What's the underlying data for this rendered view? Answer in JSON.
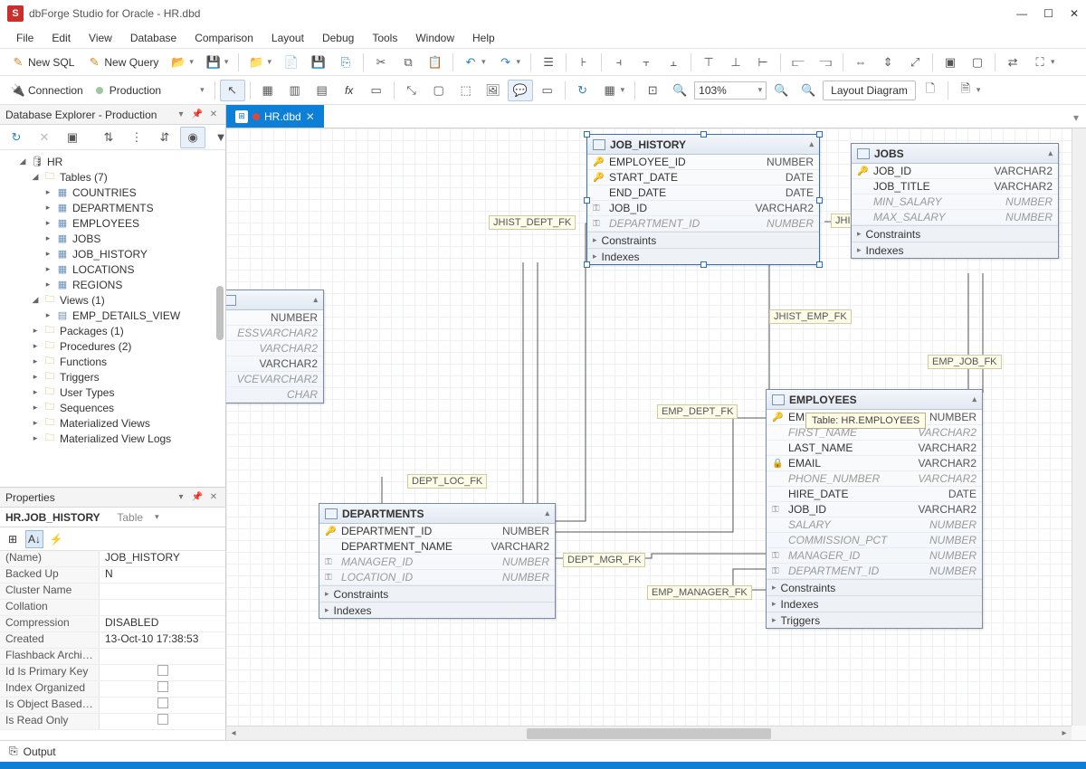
{
  "app": {
    "title": "dbForge Studio for Oracle - HR.dbd"
  },
  "menu": [
    "File",
    "Edit",
    "View",
    "Database",
    "Comparison",
    "Layout",
    "Debug",
    "Tools",
    "Window",
    "Help"
  ],
  "toolbar1": {
    "newSql": "New SQL",
    "newQuery": "New Query",
    "connection_label": "Connection",
    "connection_value": "Production"
  },
  "toolbar2": {
    "zoom": "103%",
    "layout_btn": "Layout Diagram"
  },
  "tab": {
    "label": "HR.dbd"
  },
  "explorer": {
    "title": "Database Explorer - Production",
    "db": "HR",
    "tables_label": "Tables (7)",
    "tables": [
      "COUNTRIES",
      "DEPARTMENTS",
      "EMPLOYEES",
      "JOBS",
      "JOB_HISTORY",
      "LOCATIONS",
      "REGIONS"
    ],
    "views_label": "Views (1)",
    "views": [
      "EMP_DETAILS_VIEW"
    ],
    "folders": [
      "Packages (1)",
      "Procedures (2)",
      "Functions",
      "Triggers",
      "User Types",
      "Sequences",
      "Materialized Views",
      "Materialized View Logs"
    ]
  },
  "properties": {
    "title": "Properties",
    "object": "HR.JOB_HISTORY",
    "object_type": "Table",
    "rows": [
      {
        "k": "(Name)",
        "v": "JOB_HISTORY"
      },
      {
        "k": "Backed Up",
        "v": "N"
      },
      {
        "k": "Cluster Name",
        "v": ""
      },
      {
        "k": "Collation",
        "v": ""
      },
      {
        "k": "Compression",
        "v": "DISABLED"
      },
      {
        "k": "Created",
        "v": "13-Oct-10 17:38:53"
      },
      {
        "k": "Flashback Archiv...",
        "v": ""
      },
      {
        "k": "Id Is Primary Key",
        "v": "[check]"
      },
      {
        "k": "Index Organized",
        "v": "[check]"
      },
      {
        "k": "Is Object Based ...",
        "v": "[check]"
      },
      {
        "k": "Is Read Only",
        "v": "[check]"
      }
    ]
  },
  "diagram": {
    "tooltip": "Table: HR.EMPLOYEES",
    "labels": {
      "jhist_dept": "JHIST_DEPT_FK",
      "jhist_job": "JHIST_JOB_FK",
      "jhist_emp": "JHIST_EMP_FK",
      "emp_job": "EMP_JOB_FK",
      "emp_dept": "EMP_DEPT_FK",
      "dept_mgr": "DEPT_MGR_FK",
      "emp_mgr": "EMP_MANAGER_FK",
      "dept_loc": "DEPT_LOC_FK"
    },
    "entities": {
      "job_history": {
        "name": "JOB_HISTORY",
        "cols": [
          {
            "i": "pk",
            "n": "EMPLOYEE_ID",
            "t": "NUMBER"
          },
          {
            "i": "pk",
            "n": "START_DATE",
            "t": "DATE"
          },
          {
            "i": "",
            "n": "END_DATE",
            "t": "DATE"
          },
          {
            "i": "fk",
            "n": "JOB_ID",
            "t": "VARCHAR2"
          },
          {
            "i": "fk",
            "n": "DEPARTMENT_ID",
            "t": "NUMBER",
            "grey": true
          }
        ],
        "subs": [
          "Constraints",
          "Indexes"
        ]
      },
      "jobs": {
        "name": "JOBS",
        "cols": [
          {
            "i": "pk",
            "n": "JOB_ID",
            "t": "VARCHAR2"
          },
          {
            "i": "",
            "n": "JOB_TITLE",
            "t": "VARCHAR2"
          },
          {
            "i": "",
            "n": "MIN_SALARY",
            "t": "NUMBER",
            "grey": true
          },
          {
            "i": "",
            "n": "MAX_SALARY",
            "t": "NUMBER",
            "grey": true
          }
        ],
        "subs": [
          "Constraints",
          "Indexes"
        ]
      },
      "employees": {
        "name": "EMPLOYEES",
        "cols": [
          {
            "i": "pk",
            "n": "EMPLOYEE_ID",
            "t": "NUMBER"
          },
          {
            "i": "",
            "n": "FIRST_NAME",
            "t": "VARCHAR2",
            "grey": true
          },
          {
            "i": "",
            "n": "LAST_NAME",
            "t": "VARCHAR2"
          },
          {
            "i": "uk",
            "n": "EMAIL",
            "t": "VARCHAR2"
          },
          {
            "i": "",
            "n": "PHONE_NUMBER",
            "t": "VARCHAR2",
            "grey": true
          },
          {
            "i": "",
            "n": "HIRE_DATE",
            "t": "DATE"
          },
          {
            "i": "fk",
            "n": "JOB_ID",
            "t": "VARCHAR2"
          },
          {
            "i": "",
            "n": "SALARY",
            "t": "NUMBER",
            "grey": true
          },
          {
            "i": "",
            "n": "COMMISSION_PCT",
            "t": "NUMBER",
            "grey": true
          },
          {
            "i": "fk",
            "n": "MANAGER_ID",
            "t": "NUMBER",
            "grey": true
          },
          {
            "i": "fk",
            "n": "DEPARTMENT_ID",
            "t": "NUMBER",
            "grey": true
          }
        ],
        "subs": [
          "Constraints",
          "Indexes",
          "Triggers"
        ]
      },
      "departments": {
        "name": "DEPARTMENTS",
        "cols": [
          {
            "i": "pk",
            "n": "DEPARTMENT_ID",
            "t": "NUMBER"
          },
          {
            "i": "",
            "n": "DEPARTMENT_NAME",
            "t": "VARCHAR2"
          },
          {
            "i": "fk",
            "n": "MANAGER_ID",
            "t": "NUMBER",
            "grey": true
          },
          {
            "i": "fk",
            "n": "LOCATION_ID",
            "t": "NUMBER",
            "grey": true
          }
        ],
        "subs": [
          "Constraints",
          "Indexes"
        ]
      },
      "partial": {
        "cols": [
          {
            "i": "",
            "n": "",
            "t": "NUMBER"
          },
          {
            "i": "",
            "n": "ESS",
            "t": "VARCHAR2",
            "grey": true
          },
          {
            "i": "",
            "n": "",
            "t": "VARCHAR2",
            "grey": true
          },
          {
            "i": "",
            "n": "",
            "t": "VARCHAR2"
          },
          {
            "i": "",
            "n": "VCE",
            "t": "VARCHAR2",
            "grey": true
          },
          {
            "i": "",
            "n": "",
            "t": "CHAR",
            "grey": true
          }
        ]
      }
    }
  },
  "status": {
    "output": "Output"
  }
}
